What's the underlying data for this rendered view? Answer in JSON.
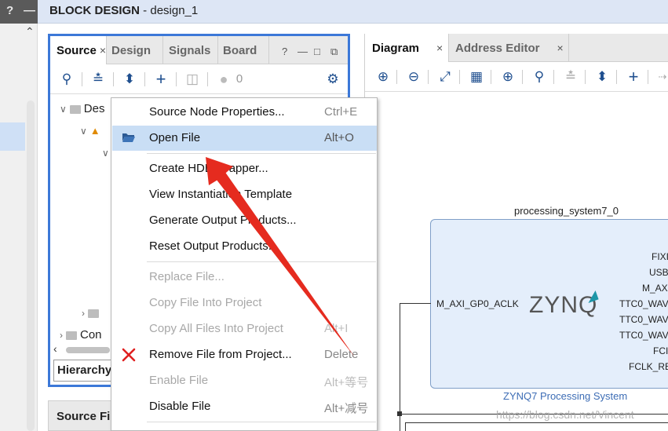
{
  "left_strip": {
    "help_glyph": "?",
    "minimize_glyph": "—"
  },
  "title_bar": {
    "title_bold": "BLOCK DESIGN",
    "title_rest": " - design_1"
  },
  "sources_panel": {
    "tabs": [
      {
        "label": "Source",
        "close": "×"
      },
      {
        "label": "Design"
      },
      {
        "label": "Signals"
      },
      {
        "label": "Board"
      }
    ],
    "controls": [
      "?",
      "—",
      "□",
      "⧉"
    ],
    "toolbar": {
      "count": "0"
    },
    "tree": {
      "row1": "Des",
      "row_con": "Con"
    },
    "hierarchy_tab": "Hierarchy"
  },
  "source_files_tab": "Source Fi",
  "diagram_panel": {
    "tabs": [
      {
        "label": "Diagram",
        "close": "×"
      },
      {
        "label": "Address Editor",
        "close": "×"
      }
    ]
  },
  "block": {
    "instance": "processing_system7_0",
    "caption": "ZYNQ7 Processing System",
    "logo": "ZYNQ",
    "input_port": "M_AXI_GP0_ACLK",
    "output_ports": [
      "FIXI",
      "USB",
      "M_AX",
      "TTC0_WAV",
      "TTC0_WAV",
      "TTC0_WAV",
      "FCI",
      "FCLK_RE"
    ]
  },
  "context_menu": {
    "items": [
      {
        "label": "Source Node Properties...",
        "shortcut": "Ctrl+E"
      },
      {
        "label": "Open File",
        "shortcut": "Alt+O"
      },
      {
        "label": "Create HDL Wrapper...",
        "shortcut": ""
      },
      {
        "label": "View Instantiation Template",
        "shortcut": ""
      },
      {
        "label": "Generate Output Products...",
        "shortcut": ""
      },
      {
        "label": "Reset Output Products...",
        "shortcut": ""
      },
      {
        "label": "Replace File...",
        "shortcut": ""
      },
      {
        "label": "Copy File Into Project",
        "shortcut": ""
      },
      {
        "label": "Copy All Files Into Project",
        "shortcut": "Alt+I"
      },
      {
        "label": "Remove File from Project...",
        "shortcut": "Delete"
      },
      {
        "label": "Enable File",
        "shortcut": "Alt+等号"
      },
      {
        "label": "Disable File",
        "shortcut": "Alt+减号"
      }
    ]
  },
  "watermark": "https://blog.csdn.net/Vincent",
  "colors": {
    "highlight": "#c9def5",
    "accent_border": "#3c78d8",
    "remove_icon": "#e02020",
    "annotation_arrow": "#e52b1f"
  }
}
